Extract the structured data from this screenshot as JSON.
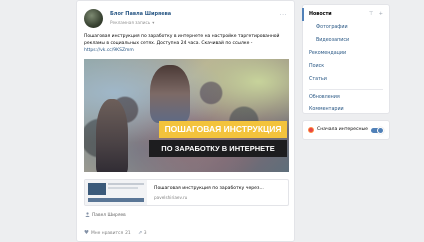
{
  "post": {
    "author": "Блог Павла Ширяева",
    "subtitle": "Рекламная запись",
    "subtitle_chevron": "▾",
    "more": "···",
    "text_before_link": "Пошаговая инструкция по заработку в интернете на настройке таргетированной рекламы в социальных сетях. Доступна 24 часа. Скачивай по ссылке - ",
    "link": "https://vk.cc/9KSZmm",
    "image": {
      "banner_line1": "ПОШАГОВАЯ ИНСТРУКЦИЯ",
      "banner_line2": "ПО ЗАРАБОТКУ В ИНТЕРНЕТЕ",
      "banner_colors": {
        "top": "#f3c33c",
        "bottom": "#1d1d1f"
      }
    },
    "link_card": {
      "title": "Пошаговая инструкция по заработку через...",
      "domain": "pavelshiriaev.ru"
    },
    "signer": "Павел Ширяев",
    "likes_label": "Мне нравится",
    "likes_count": "21",
    "shares_count": "3",
    "icons": {
      "like": "heart-icon",
      "share": "share-icon",
      "signer": "person-icon"
    }
  },
  "menu": {
    "items": [
      {
        "label": "Новости",
        "active": true
      },
      {
        "label": "Фотографии",
        "sub": true
      },
      {
        "label": "Видеозаписи",
        "sub": true
      },
      {
        "label": "Рекомендации"
      },
      {
        "label": "Поиск"
      },
      {
        "label": "Статьи"
      },
      {
        "label": "Обновления"
      },
      {
        "label": "Комментарии"
      }
    ],
    "header_icons": [
      "filter-icon",
      "add-icon"
    ]
  },
  "filter": {
    "label": "Сначала интересные",
    "toggle_on": true
  },
  "colors": {
    "link": "#2a5885",
    "accent": "#5181b8",
    "background": "#edeef0"
  }
}
